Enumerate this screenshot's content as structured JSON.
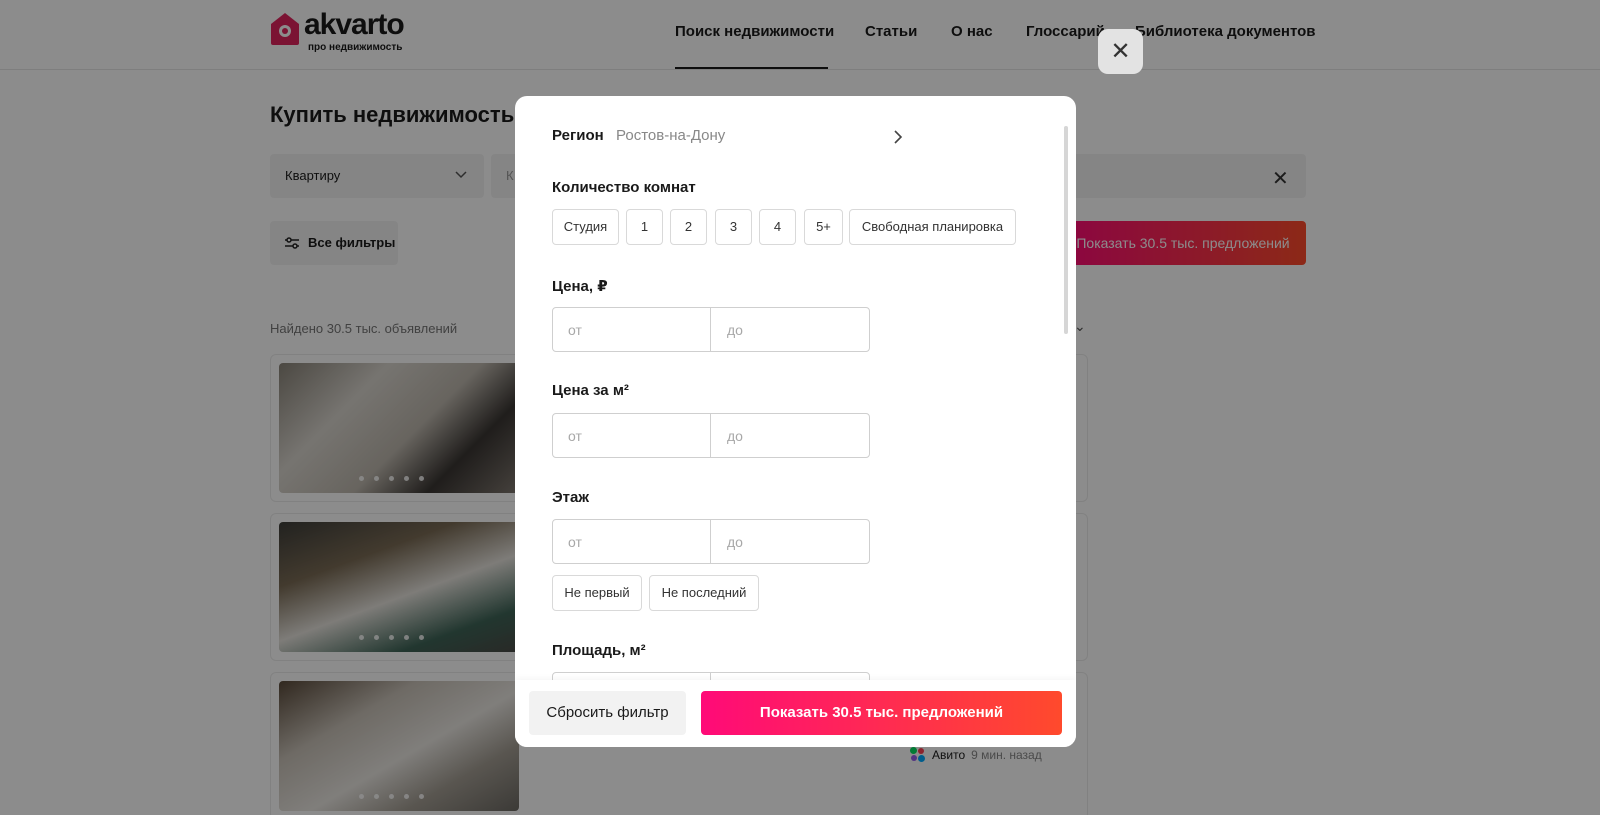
{
  "header": {
    "logo_text": "akvarto",
    "logo_sub": "про недвижимость",
    "nav": [
      {
        "label": "Поиск недвижимости"
      },
      {
        "label": "Статьи"
      },
      {
        "label": "О нас"
      },
      {
        "label": "Глоссарий"
      },
      {
        "label": "Библиотека документов"
      }
    ]
  },
  "page": {
    "title": "Купить недвижимость",
    "property_type": "Квартиру",
    "search_placeholder": "К",
    "all_filters_label": "Все фильтры",
    "show_offers_label": "Показать 30.5 тыс. предложений",
    "found_text": "Найдено 30.5 тыс. объявлений",
    "listing_source": "Авито",
    "listing_time": "9 мин. назад"
  },
  "modal": {
    "region_label": "Регион",
    "region_value": "Ростов-на-Дону",
    "rooms_label": "Количество комнат",
    "rooms_options": [
      "Студия",
      "1",
      "2",
      "3",
      "4",
      "5+",
      "Свободная планировка"
    ],
    "price_label": "Цена, ₽",
    "price_per_m2_label": "Цена за м²",
    "floor_label": "Этаж",
    "floor_options": [
      "Не первый",
      "Не последний"
    ],
    "area_label": "Площадь, м²",
    "from_placeholder": "от",
    "to_placeholder": "до",
    "reset_label": "Сбросить фильтр",
    "show_label": "Показать 30.5 тыс. предложений",
    "close_symbol": "✕"
  },
  "colors": {
    "accent_start": "#ff0a78",
    "accent_end": "#ff4a2c",
    "logo": "#e0245e"
  }
}
